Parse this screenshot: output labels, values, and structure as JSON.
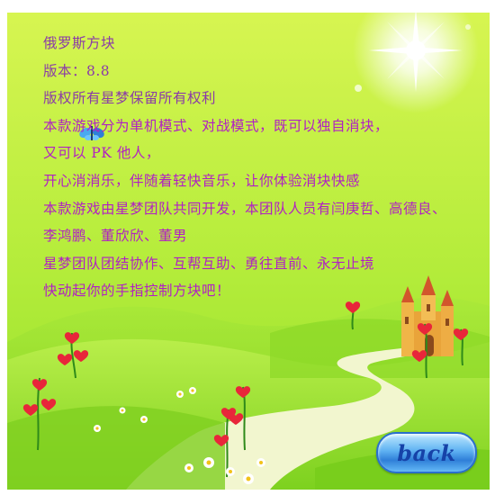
{
  "info": {
    "title": "俄罗斯方块",
    "version": "版本：8.8",
    "copyright": "版权所有星梦保留所有权利",
    "lines": [
      "本款游戏分为单机模式、对战模式，既可以独自消块，",
      "又可以 PK 他人，",
      "开心消消乐，伴随着轻快音乐，让你体验消块快感",
      "本款游戏由星梦团队共同开发，本团队人员有闫庚哲、高德良、",
      "李鸿鹏、董欣欣、董男",
      "星梦团队团结协作、互帮互助、勇往直前、永无止境",
      "快动起你的手指控制方块吧！"
    ]
  },
  "back_button": {
    "label": "back"
  },
  "colors": {
    "sky_top": "#cdf24a",
    "sky_bottom": "#9ce62f",
    "grass": "#7ccf1c",
    "path": "#f4f7d6",
    "text_muted": "#8a3aa8",
    "text_strong": "#b11fc4",
    "button_blue": "#3d8ee6"
  },
  "icons": [
    "sun-icon",
    "butterfly-icon",
    "castle-icon",
    "heart-flower-icon",
    "daisy-icon"
  ]
}
